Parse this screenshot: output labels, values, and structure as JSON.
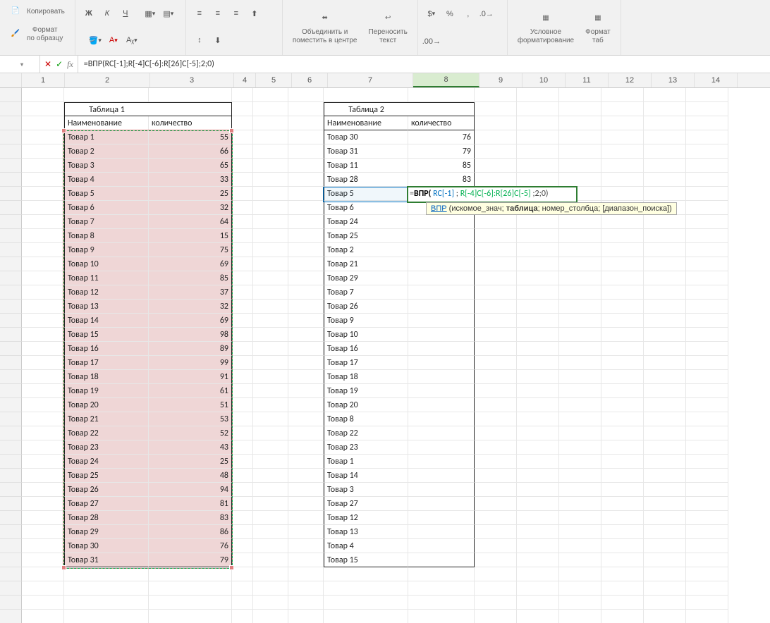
{
  "ribbon": {
    "copy": "Копировать",
    "fmtpaint": "Формат\nпо образцу",
    "merge": "Объединить и\nпоместить в центре",
    "wrap": "Переносить\nтекст",
    "condfmt": "Условное\nформатирование",
    "fmttbl": "Формат\nтаб"
  },
  "namebox": "",
  "formula": "=ВПР(RC[-1];R[-4]C[-6]:R[26]C[-5];2;0)",
  "edit": {
    "pre": "=",
    "kw": "ВПР(",
    "a1": " RC[-1] ",
    "sep1": "; ",
    "a2": "R[-4]C[-6]:R[26]C[-5] ",
    "tail": ";2;0)"
  },
  "tooltip": {
    "fn": "ВПР",
    "p1": "искомое_знач",
    "p2": "таблица",
    "p3": "номер_столбца",
    "p4": "[диапазон_поиска]"
  },
  "t1": {
    "title": "Таблица 1",
    "h1": "Наименование",
    "h2": "количество",
    "rows": [
      {
        "n": "Товар 1",
        "q": 55
      },
      {
        "n": "Товар 2",
        "q": 66
      },
      {
        "n": "Товар 3",
        "q": 65
      },
      {
        "n": "Товар 4",
        "q": 33
      },
      {
        "n": "Товар 5",
        "q": 25
      },
      {
        "n": "Товар 6",
        "q": 32
      },
      {
        "n": "Товар 7",
        "q": 64
      },
      {
        "n": "Товар 8",
        "q": 15
      },
      {
        "n": "Товар 9",
        "q": 75
      },
      {
        "n": "Товар 10",
        "q": 69
      },
      {
        "n": "Товар 11",
        "q": 85
      },
      {
        "n": "Товар 12",
        "q": 37
      },
      {
        "n": "Товар 13",
        "q": 32
      },
      {
        "n": "Товар 14",
        "q": 69
      },
      {
        "n": "Товар 15",
        "q": 98
      },
      {
        "n": "Товар 16",
        "q": 89
      },
      {
        "n": "Товар 17",
        "q": 99
      },
      {
        "n": "Товар 18",
        "q": 91
      },
      {
        "n": "Товар 19",
        "q": 61
      },
      {
        "n": "Товар 20",
        "q": 51
      },
      {
        "n": "Товар 21",
        "q": 53
      },
      {
        "n": "Товар 22",
        "q": 52
      },
      {
        "n": "Товар 23",
        "q": 43
      },
      {
        "n": "Товар 24",
        "q": 25
      },
      {
        "n": "Товар 25",
        "q": 48
      },
      {
        "n": "Товар 26",
        "q": 94
      },
      {
        "n": "Товар 27",
        "q": 81
      },
      {
        "n": "Товар 28",
        "q": 83
      },
      {
        "n": "Товар 29",
        "q": 86
      },
      {
        "n": "Товар 30",
        "q": 76
      },
      {
        "n": "Товар 31",
        "q": 79
      }
    ]
  },
  "t2": {
    "title": "Таблица 2",
    "h1": "Наименование",
    "h2": "количество",
    "rows": [
      {
        "n": "Товар 30",
        "q": 76
      },
      {
        "n": "Товар 31",
        "q": 79
      },
      {
        "n": "Товар 11",
        "q": 85
      },
      {
        "n": "Товар 28",
        "q": 83
      },
      {
        "n": "Товар 5",
        "q": ""
      },
      {
        "n": "Товар 6",
        "q": ""
      },
      {
        "n": "Товар 24",
        "q": ""
      },
      {
        "n": "Товар 25",
        "q": ""
      },
      {
        "n": "Товар 2",
        "q": ""
      },
      {
        "n": "Товар 21",
        "q": ""
      },
      {
        "n": "Товар 29",
        "q": ""
      },
      {
        "n": "Товар 7",
        "q": ""
      },
      {
        "n": "Товар 26",
        "q": ""
      },
      {
        "n": "Товар 9",
        "q": ""
      },
      {
        "n": "Товар 10",
        "q": ""
      },
      {
        "n": "Товар 16",
        "q": ""
      },
      {
        "n": "Товар 17",
        "q": ""
      },
      {
        "n": "Товар 18",
        "q": ""
      },
      {
        "n": "Товар 19",
        "q": ""
      },
      {
        "n": "Товар 20",
        "q": ""
      },
      {
        "n": "Товар 8",
        "q": ""
      },
      {
        "n": "Товар 22",
        "q": ""
      },
      {
        "n": "Товар 23",
        "q": ""
      },
      {
        "n": "Товар 1",
        "q": ""
      },
      {
        "n": "Товар 14",
        "q": ""
      },
      {
        "n": "Товар 3",
        "q": ""
      },
      {
        "n": "Товар 27",
        "q": ""
      },
      {
        "n": "Товар 12",
        "q": ""
      },
      {
        "n": "Товар 13",
        "q": ""
      },
      {
        "n": "Товар 4",
        "q": ""
      },
      {
        "n": "Товар 15",
        "q": ""
      }
    ]
  },
  "cols": [
    "1",
    "2",
    "3",
    "4",
    "5",
    "6",
    "7",
    "8",
    "9",
    "10",
    "11",
    "12",
    "13",
    "14"
  ]
}
